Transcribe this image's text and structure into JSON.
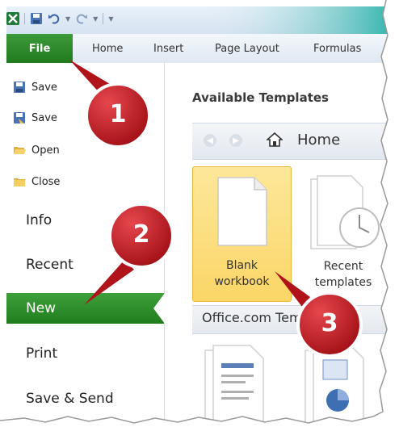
{
  "quick_access": {
    "app_icon": "excel-logo-icon",
    "save_icon": "save-icon",
    "undo_icon": "undo-icon",
    "redo_icon": "redo-icon",
    "customize_icon": "customize-qat-icon"
  },
  "ribbon": {
    "file_label": "File",
    "tabs": [
      "Home",
      "Insert",
      "Page Layout",
      "Formulas"
    ]
  },
  "backstage": {
    "commands": [
      {
        "label": "Save",
        "icon": "save-icon"
      },
      {
        "label": "Save",
        "icon": "save-as-icon"
      },
      {
        "label": "Open",
        "icon": "open-folder-icon"
      },
      {
        "label": "Close",
        "icon": "close-folder-icon"
      }
    ],
    "items": [
      "Info",
      "Recent",
      "New",
      "Print",
      "Save & Send"
    ],
    "active_item": "New"
  },
  "templates": {
    "heading": "Available Templates",
    "nav": {
      "back_icon": "back-arrow-icon",
      "forward_icon": "forward-arrow-icon",
      "home_icon": "home-icon",
      "home_label": "Home"
    },
    "tiles": [
      {
        "line1": "Blank",
        "line2": "workbook",
        "selected": true
      },
      {
        "line1": "Recent",
        "line2": "templates",
        "selected": false
      }
    ],
    "section_label": "Office.com Templates"
  },
  "callouts": [
    "1",
    "2",
    "3"
  ],
  "colors": {
    "file_tab": "#2a8a27",
    "active_item": "#2f8f2c",
    "selected_tile": "#fbd96f",
    "callout": "#c0141c"
  }
}
